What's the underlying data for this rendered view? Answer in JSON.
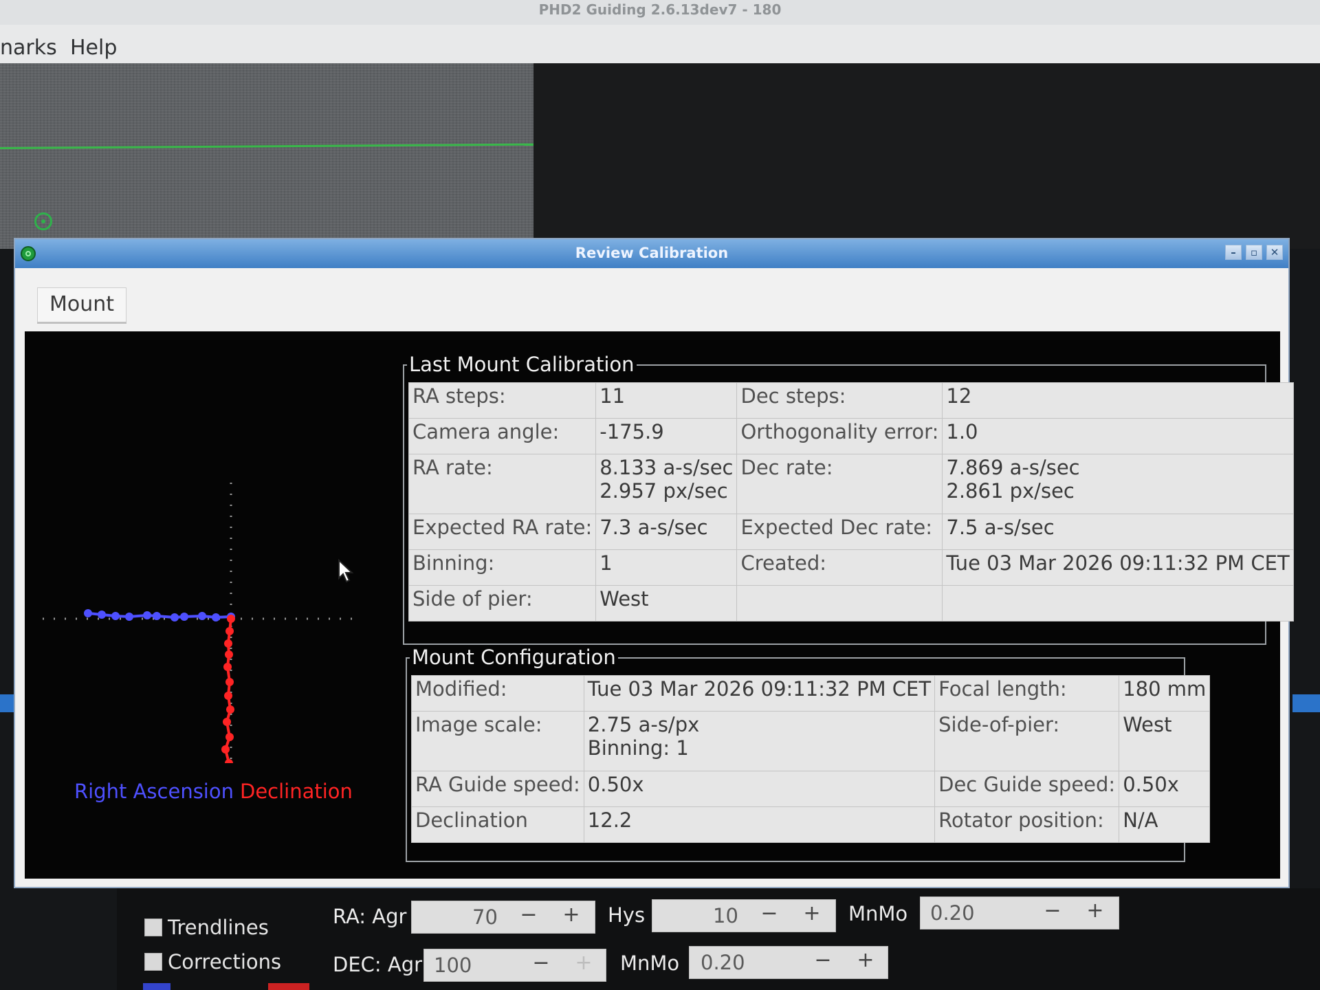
{
  "app": {
    "title": "PHD2 Guiding 2.6.13dev7 - 180",
    "menu": [
      "narks",
      "Help"
    ]
  },
  "dialog": {
    "title": "Review Calibration",
    "buttons": [
      "–",
      "▫",
      "✕"
    ],
    "tab_label": "Mount"
  },
  "graph": {
    "legend_ra": "Right Ascension",
    "legend_dec": "Declination",
    "colors": {
      "ra": "#4e50ff",
      "dec": "#ff2424",
      "axis": "#9a9a9a"
    }
  },
  "last_calibration": {
    "title": "Last Mount Calibration",
    "rows": [
      {
        "l1": "RA steps:",
        "v1": "11",
        "l2": "Dec steps:",
        "v2": "12"
      },
      {
        "l1": "Camera angle:",
        "v1": "-175.9",
        "l2": "Orthogonality error:",
        "v2": "1.0"
      },
      {
        "l1": "RA rate:",
        "v1a": "8.133 a-s/sec",
        "v1b": "2.957 px/sec",
        "l2": "Dec rate:",
        "v2a": "7.869 a-s/sec",
        "v2b": "2.861 px/sec"
      },
      {
        "l1": "Expected RA rate:",
        "v1": "7.3 a-s/sec",
        "l2": "Expected Dec rate:",
        "v2": "7.5 a-s/sec"
      },
      {
        "l1": "Binning:",
        "v1": "1",
        "l2": "Created:",
        "v2": "Tue 03 Mar 2026 09:11:32 PM CET"
      },
      {
        "l1": "Side of pier:",
        "v1": "West",
        "l2": "",
        "v2": ""
      }
    ]
  },
  "mount_config": {
    "title": "Mount Configuration",
    "rows": [
      {
        "l1": "Modified:",
        "v1": "Tue 03 Mar 2026 09:11:32 PM CET",
        "l2": "Focal length:",
        "v2": "180 mm"
      },
      {
        "l1": "Image scale:",
        "v1a": "2.75 a-s/px",
        "v1b": "Binning: 1",
        "l2": "Side-of-pier:",
        "v2": "West"
      },
      {
        "l1": "RA Guide speed:",
        "v1": "0.50x",
        "l2": "Dec Guide speed:",
        "v2": "0.50x"
      },
      {
        "l1": "Declination",
        "v1": "12.2",
        "l2": "Rotator position:",
        "v2": "N/A"
      }
    ]
  },
  "controls": {
    "trendlines": "Trendlines",
    "corrections": "Corrections",
    "ra_agr_label": "RA: Agr",
    "ra_agr_value": "70",
    "hys_label": "Hys",
    "hys_value": "10",
    "mnmo_label_1": "MnMo",
    "mnmo_value_1": "0.20",
    "dec_agr_label": "DEC: Agr",
    "dec_agr_value": "100",
    "mnmo_label_2": "MnMo",
    "mnmo_value_2": "0.20",
    "minus": "−",
    "plus": "+"
  }
}
